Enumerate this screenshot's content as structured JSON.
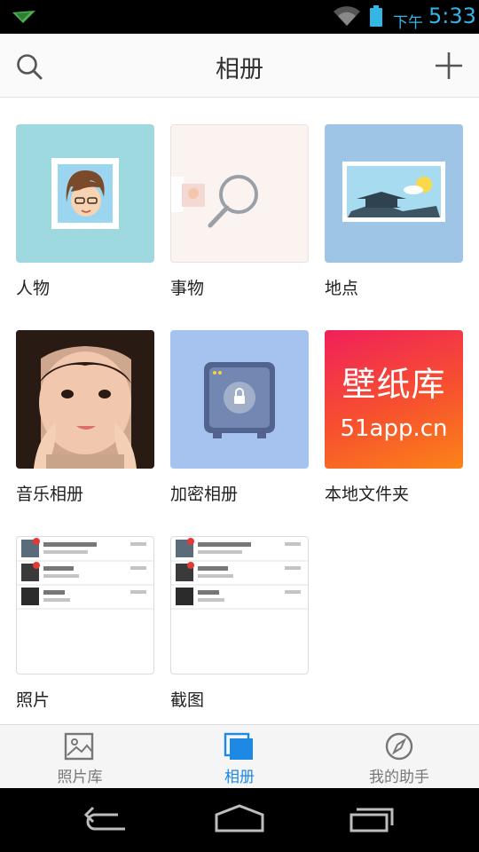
{
  "status_bar": {
    "ampm": "下午",
    "time": "5:33"
  },
  "header": {
    "title": "相册",
    "icons": [
      "search-icon",
      "add-icon"
    ]
  },
  "albums": [
    {
      "label": "人物",
      "icon": "person-portrait-icon",
      "bg": "#9fd9e0"
    },
    {
      "label": "事物",
      "icon": "magnifier-icon",
      "bg": "#fbf3ef"
    },
    {
      "label": "地点",
      "icon": "landscape-pagoda-icon",
      "bg": "#9ec4e6"
    },
    {
      "label": "音乐相册",
      "icon": "girl-photo-thumbnail"
    },
    {
      "label": "加密相册",
      "icon": "safe-lock-icon",
      "bg": "#a6c2ee"
    },
    {
      "label": "本地文件夹",
      "icon": "wallpaper-app-thumbnail",
      "thumb_text_top": "壁纸库",
      "thumb_text_bottom": "51app.cn"
    },
    {
      "label": "照片",
      "icon": "chat-screenshot-thumbnail"
    },
    {
      "label": "截图",
      "icon": "chat-screenshot-thumbnail"
    }
  ],
  "bottom_nav": [
    {
      "label": "照片库",
      "icon": "picture-icon",
      "active": false
    },
    {
      "label": "相册",
      "icon": "album-stack-icon",
      "active": true
    },
    {
      "label": "我的助手",
      "icon": "compass-icon",
      "active": false
    }
  ],
  "colors": {
    "accent": "#1e88e5",
    "inactive": "#777777",
    "status_accent": "#33b5e5"
  }
}
